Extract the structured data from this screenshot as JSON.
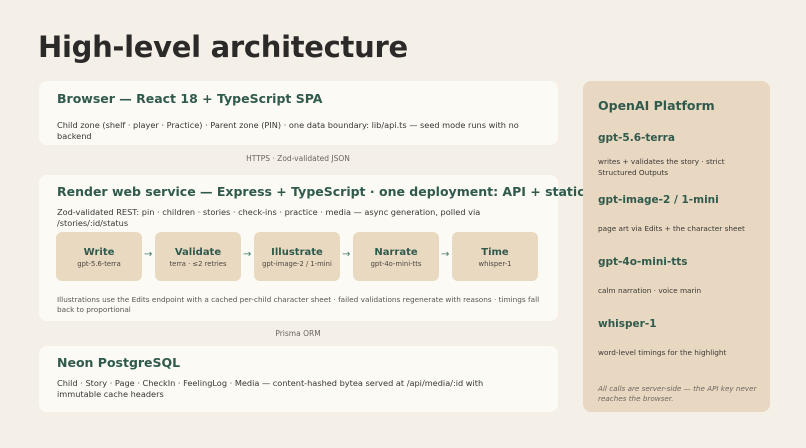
{
  "title": "High-level architecture",
  "browser": {
    "title": "Browser — React 18 + TypeScript SPA",
    "text": "Child zone (shelf · player · Practice) · Parent zone (PIN) · one data boundary: lib/api.ts — seed mode runs with no backend"
  },
  "link1": "HTTPS · Zod-validated JSON",
  "render": {
    "title": "Render web service — Express + TypeScript · one deployment: API + static frontend",
    "text": "Zod-validated REST: pin · children · stories · check-ins · practice · media — async generation, polled via /stories/:id/status",
    "steps": [
      {
        "name": "Write",
        "sub": "gpt-5.6-terra"
      },
      {
        "name": "Validate",
        "sub": "terra · ≤2 retries"
      },
      {
        "name": "Illustrate",
        "sub": "gpt-image-2 / 1-mini"
      },
      {
        "name": "Narrate",
        "sub": "gpt-4o-mini-tts"
      },
      {
        "name": "Time",
        "sub": "whisper-1"
      }
    ],
    "arrow": "→",
    "note": "Illustrations use the Edits endpoint with a cached per-child character sheet · failed validations regenerate with reasons · timings fall back to proportional"
  },
  "link2": "Prisma ORM",
  "db": {
    "title": "Neon PostgreSQL",
    "text": "Child · Story · Page · CheckIn · FeelingLog · Media — content-hashed bytea served at /api/media/:id with immutable cache headers"
  },
  "openai": {
    "title": "OpenAI Platform",
    "models": [
      {
        "name": "gpt-5.6-terra",
        "desc": "writes + validates the story · strict Structured Outputs"
      },
      {
        "name": "gpt-image-2 / 1-mini",
        "desc": "page art via Edits + the character sheet"
      },
      {
        "name": "gpt-4o-mini-tts",
        "desc": "calm narration · voice marin"
      },
      {
        "name": "whisper-1",
        "desc": "word-level timings for the highlight"
      }
    ],
    "note": "All calls are server-side — the API key never reaches the browser."
  }
}
